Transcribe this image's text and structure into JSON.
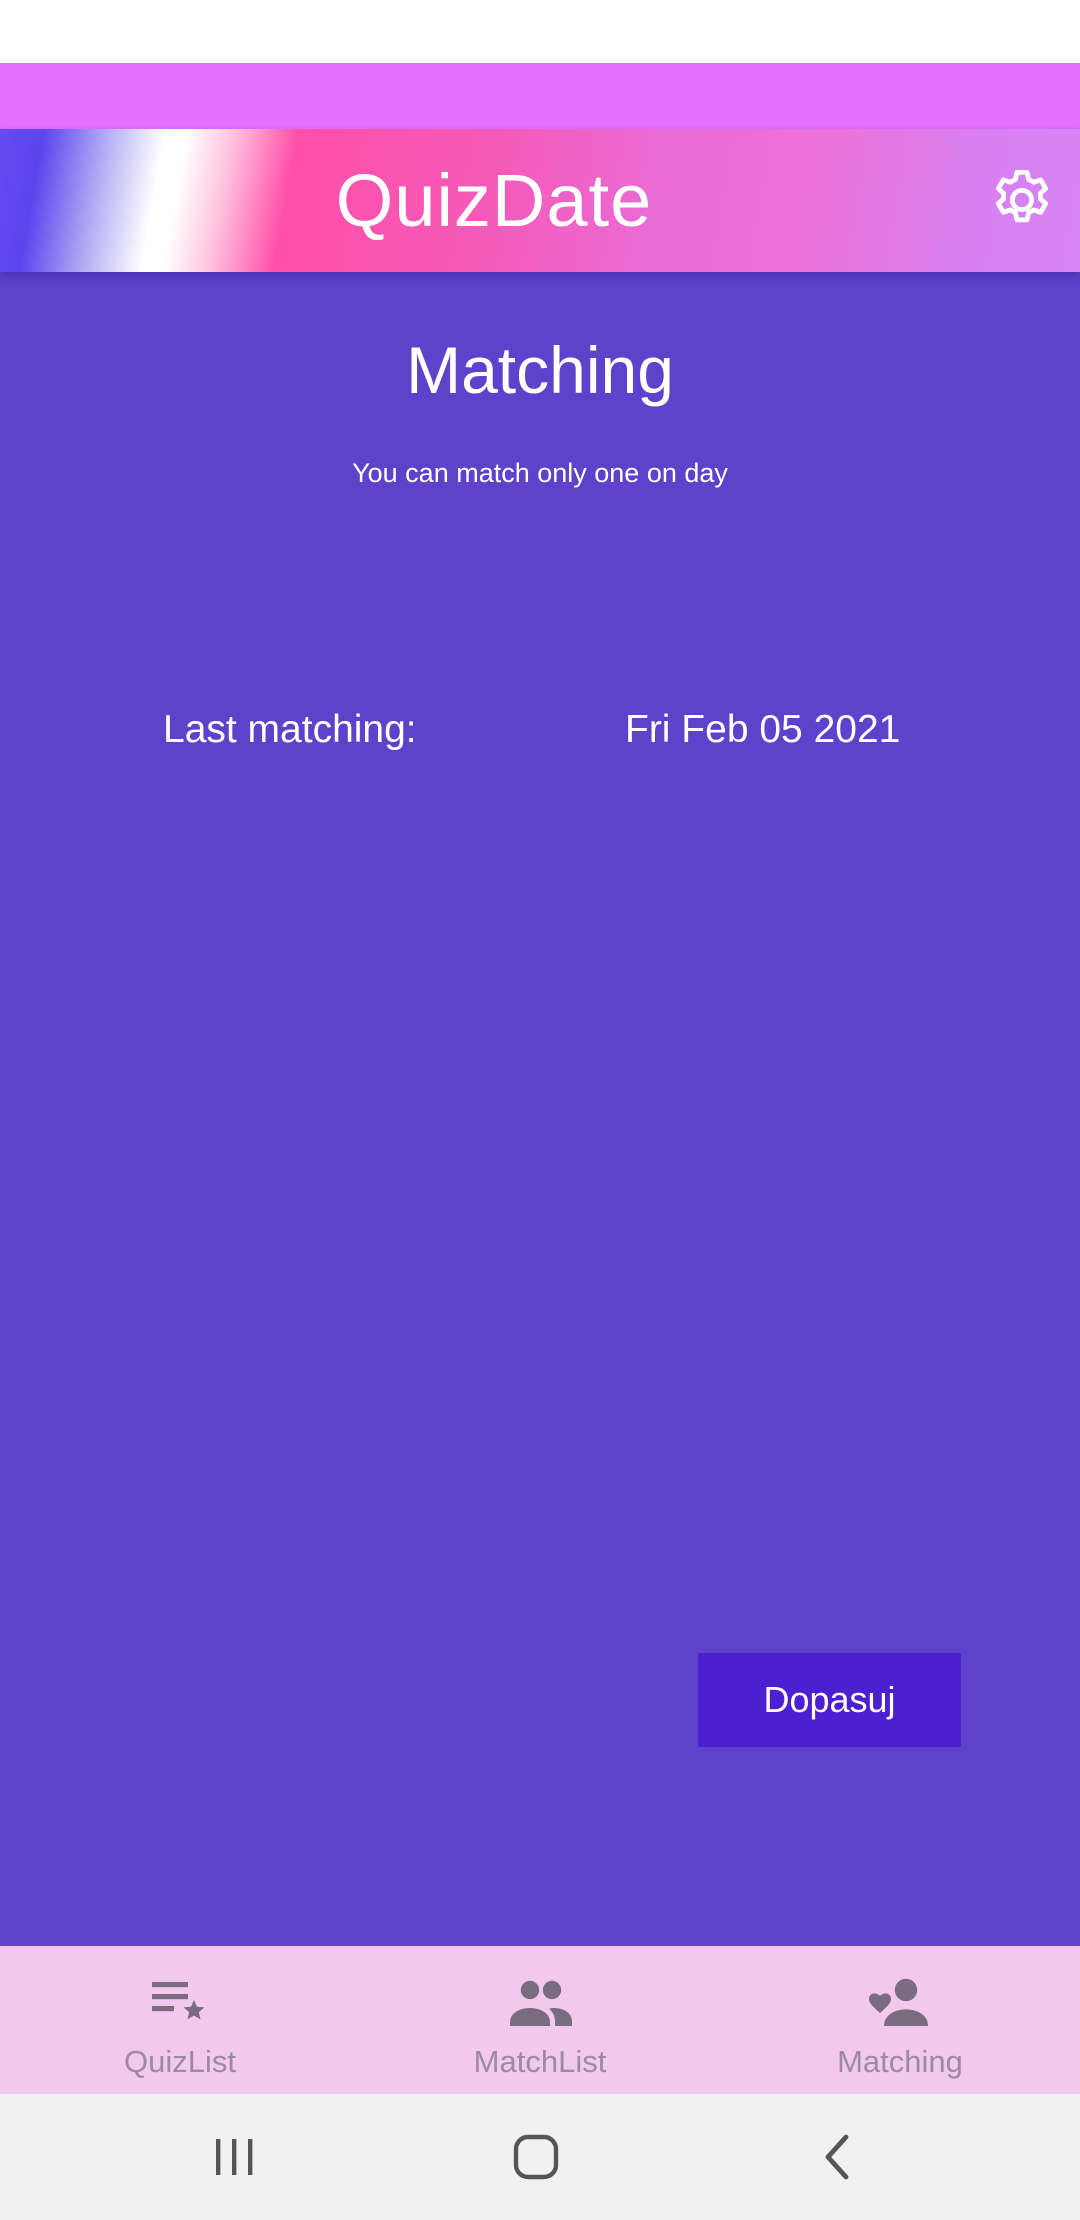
{
  "app": {
    "title": "QuizDate"
  },
  "page": {
    "title": "Matching",
    "subtitle": "You can match only one on day",
    "last_matching_label": "Last matching:",
    "last_matching_value": "Fri Feb 05 2021",
    "match_button_label": "Dopasuj"
  },
  "bottom_nav": {
    "items": [
      {
        "label": "QuizList",
        "icon": "playlist-star-icon"
      },
      {
        "label": "MatchList",
        "icon": "people-icon"
      },
      {
        "label": "Matching",
        "icon": "favorite-person-icon"
      }
    ]
  },
  "colors": {
    "status_bar": "#e46ffe",
    "content_background": "#5e42cb",
    "button_background": "#4c1fd1",
    "bottom_nav_background": "#f2c8ef",
    "bottom_nav_icon": "#7a6c80",
    "bottom_nav_text": "#9b8b9e",
    "system_nav_background": "#f1f1f1"
  },
  "icons": {
    "settings": "gear-icon",
    "system_recents": "recents-icon",
    "system_home": "home-icon",
    "system_back": "back-icon"
  }
}
